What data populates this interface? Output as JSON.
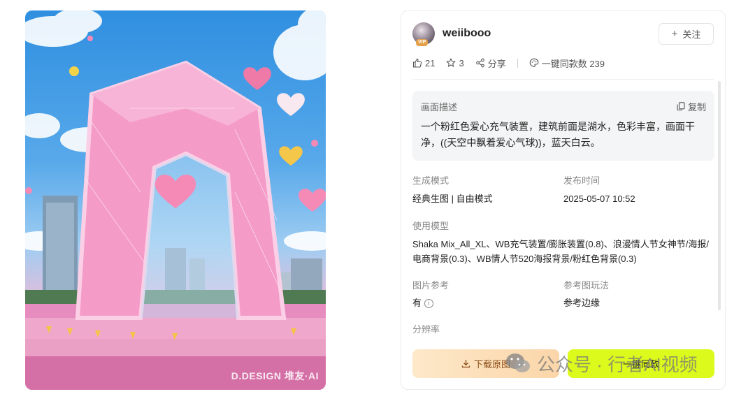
{
  "artwork": {
    "credit": "D.DESIGN 堆友·AI",
    "colors": {
      "sky": "#3d95e4",
      "arch": "#f39ac8",
      "water": "#e07cb3"
    }
  },
  "user": {
    "name": "weiibooo",
    "vip_badge": "VIP",
    "follow_label": "关注"
  },
  "stats": {
    "likes": "21",
    "favorites": "3",
    "share_label": "分享",
    "same_count_label": "一键同款数 239"
  },
  "description": {
    "title": "画面描述",
    "copy_label": "复制",
    "text": "一个粉红色爱心充气装置，建筑前面是湖水，色彩丰富，画面干净，((天空中飘着爱心气球))，蓝天白云。"
  },
  "details": {
    "mode_label": "生成模式",
    "mode_value": "经典生图 | 自由模式",
    "time_label": "发布时间",
    "time_value": "2025-05-07 10:52",
    "model_label": "使用模型",
    "model_value": "Shaka Mix_All_XL、WB充气装置/膨胀装置(0.8)、浪漫情人节女神节/海报/电商背景(0.3)、WB情人节520海报背景/粉红色背景(0.3)",
    "ref_label": "图片参考",
    "ref_value": "有",
    "ref_method_label": "参考图玩法",
    "ref_method_value": "参考边缘",
    "resolution_label": "分辨率"
  },
  "actions": {
    "download_label": "下载原图",
    "same_label": "一键同款",
    "same_color": "#dcfa1c"
  },
  "watermark": {
    "text": "公众号 · 行者AI视频"
  }
}
